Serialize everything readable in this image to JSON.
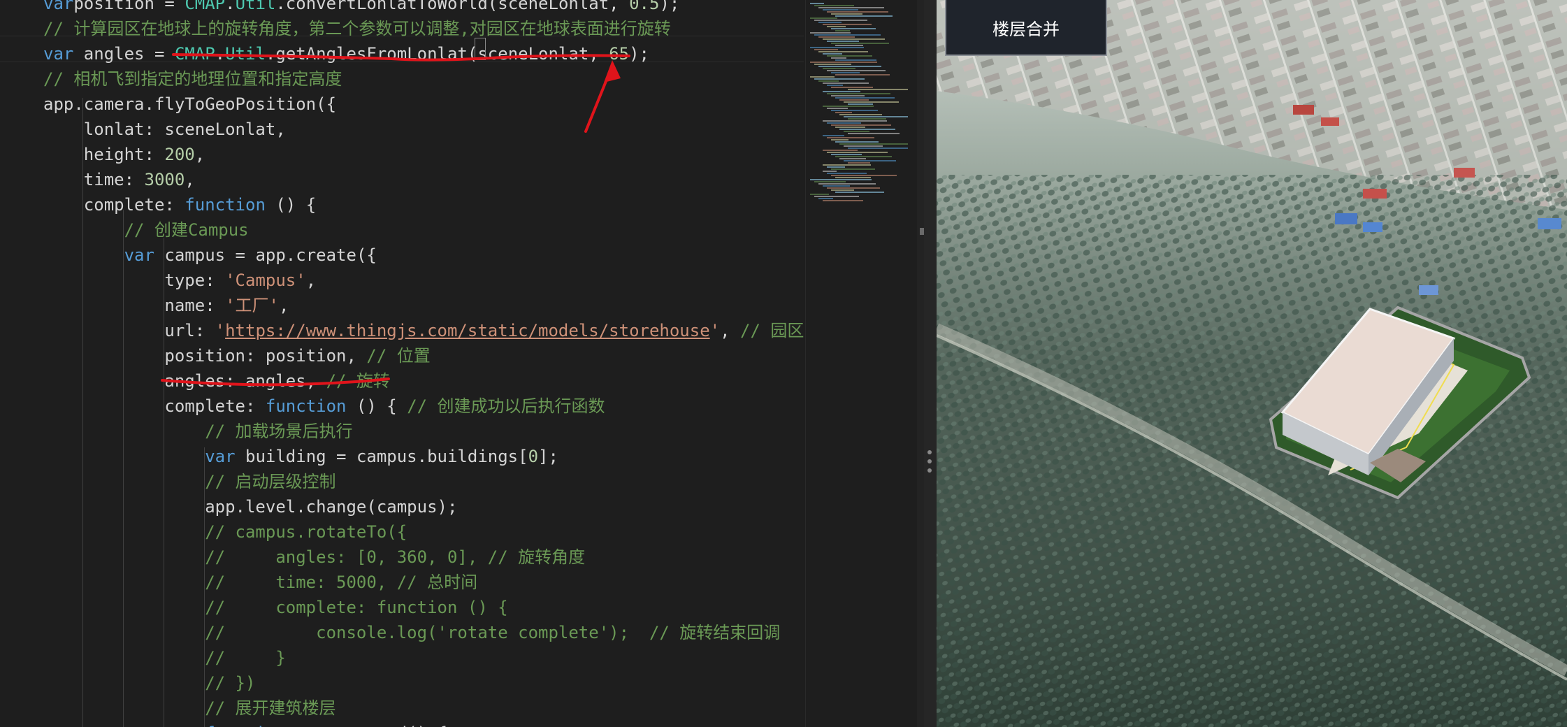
{
  "editor": {
    "lines": [
      {
        "id": "l1",
        "segs": [
          [
            "kw",
            "var"
          ],
          [
            "",
            "position = "
          ],
          [
            "cls",
            "CMAP"
          ],
          [
            "",
            "."
          ],
          [
            "cls",
            "Util"
          ],
          [
            "",
            ".convertLonlatToWorld(sceneLonlat, "
          ],
          [
            "nm",
            "0.5"
          ],
          [
            "",
            ");"
          ]
        ]
      },
      {
        "id": "l2",
        "segs": [
          [
            "cm",
            "// 计算园区在地球上的旋转角度，第二个参数可以调整,对园区在地球表面进行旋转"
          ]
        ]
      },
      {
        "id": "l3",
        "segs": [
          [
            "kw",
            "var"
          ],
          [
            "",
            " angles = "
          ],
          [
            "cls",
            "CMAP"
          ],
          [
            "",
            "."
          ],
          [
            "cls",
            "Util"
          ],
          [
            "",
            ".getAnglesFromLonlat"
          ],
          [
            "",
            "(sceneLonlat, "
          ],
          [
            "nm",
            "65"
          ],
          [
            "",
            ");"
          ]
        ]
      },
      {
        "id": "l4",
        "segs": [
          [
            "cm",
            "// 相机飞到指定的地理位置和指定高度"
          ]
        ]
      },
      {
        "id": "l5",
        "segs": [
          [
            "",
            "app.camera.flyToGeoPosition({"
          ]
        ]
      },
      {
        "id": "l6",
        "segs": [
          [
            "",
            "    lonlat: sceneLonlat,"
          ]
        ]
      },
      {
        "id": "l7",
        "segs": [
          [
            "",
            "    height: "
          ],
          [
            "nm",
            "200"
          ],
          [
            "",
            ","
          ]
        ]
      },
      {
        "id": "l8",
        "segs": [
          [
            "",
            "    time: "
          ],
          [
            "nm",
            "3000"
          ],
          [
            "",
            ","
          ]
        ]
      },
      {
        "id": "l9",
        "segs": [
          [
            "",
            "    complete: "
          ],
          [
            "kw",
            "function"
          ],
          [
            "",
            " () {"
          ]
        ]
      },
      {
        "id": "l10",
        "segs": [
          [
            "cm",
            "        // 创建Campus"
          ]
        ]
      },
      {
        "id": "l11",
        "segs": [
          [
            "",
            "        "
          ],
          [
            "kw",
            "var"
          ],
          [
            "",
            " campus = app.create({"
          ]
        ]
      },
      {
        "id": "l12",
        "segs": [
          [
            "",
            "            type: "
          ],
          [
            "st",
            "'Campus'"
          ],
          [
            "",
            ","
          ]
        ]
      },
      {
        "id": "l13",
        "segs": [
          [
            "",
            "            name: "
          ],
          [
            "st",
            "'工厂'"
          ],
          [
            "",
            ","
          ]
        ]
      },
      {
        "id": "l14",
        "segs": [
          [
            "",
            "            url: "
          ],
          [
            "st",
            "'"
          ],
          [
            "url",
            "https://www.thingjs.com/static/models/storehouse"
          ],
          [
            "st",
            "'"
          ],
          [
            "",
            ", "
          ],
          [
            "cm",
            "// 园区地址"
          ]
        ]
      },
      {
        "id": "l15",
        "segs": [
          [
            "",
            "            position: position, "
          ],
          [
            "cm",
            "// 位置"
          ]
        ]
      },
      {
        "id": "l16",
        "segs": [
          [
            "",
            "            angles: angles, "
          ],
          [
            "cm",
            "// 旋转"
          ]
        ]
      },
      {
        "id": "l17",
        "segs": [
          [
            "",
            "            complete: "
          ],
          [
            "kw",
            "function"
          ],
          [
            "",
            " () { "
          ],
          [
            "cm",
            "// 创建成功以后执行函数"
          ]
        ]
      },
      {
        "id": "l18",
        "segs": [
          [
            "cm",
            "                // 加载场景后执行"
          ]
        ]
      },
      {
        "id": "l19",
        "segs": [
          [
            "",
            "                "
          ],
          [
            "kw",
            "var"
          ],
          [
            "",
            " building = campus.buildings["
          ],
          [
            "nm",
            "0"
          ],
          [
            "",
            "];"
          ]
        ]
      },
      {
        "id": "l20",
        "segs": [
          [
            "cm",
            "                // 启动层级控制"
          ]
        ]
      },
      {
        "id": "l21",
        "segs": [
          [
            "",
            "                app.level.change(campus);"
          ]
        ]
      },
      {
        "id": "l22",
        "segs": [
          [
            "cm",
            "                // campus.rotateTo({"
          ]
        ]
      },
      {
        "id": "l23",
        "segs": [
          [
            "cm",
            "                //     angles: [0, 360, 0], // 旋转角度"
          ]
        ]
      },
      {
        "id": "l24",
        "segs": [
          [
            "cm",
            "                //     time: 5000, // 总时间"
          ]
        ]
      },
      {
        "id": "l25",
        "segs": [
          [
            "cm",
            "                //     complete: function () {"
          ]
        ]
      },
      {
        "id": "l26",
        "segs": [
          [
            "cm",
            "                //         console.log('rotate complete');  // 旋转结束回调"
          ]
        ]
      },
      {
        "id": "l27",
        "segs": [
          [
            "cm",
            "                //     }"
          ]
        ]
      },
      {
        "id": "l28",
        "segs": [
          [
            "cm",
            "                // })"
          ]
        ]
      },
      {
        "id": "l29",
        "segs": [
          [
            "cm",
            "                // 展开建筑楼层"
          ]
        ]
      },
      {
        "id": "l30",
        "segs": [
          [
            "",
            "                "
          ],
          [
            "kw",
            "function"
          ],
          [
            "",
            " test_expand() {"
          ]
        ]
      }
    ]
  },
  "viewport": {
    "merge_button_label": "楼层合并"
  },
  "colors": {
    "annotation_red": "#e0141b",
    "editor_bg": "#1e1e1e",
    "button_bg": "#1f242c"
  }
}
